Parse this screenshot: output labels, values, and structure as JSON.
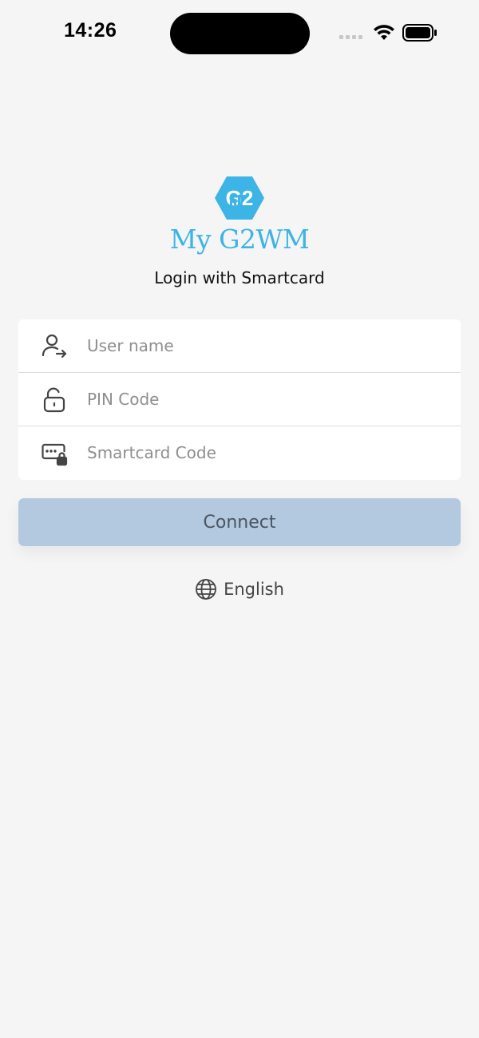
{
  "status_bar": {
    "time": "14:26"
  },
  "app": {
    "logo_text": "My G2WM",
    "logo_mark": "G2",
    "subtitle": "Login with Smartcard",
    "brand_color": "#3db4e6"
  },
  "form": {
    "username": {
      "placeholder": "User name",
      "value": "",
      "icon": "user-arrow-icon"
    },
    "pin": {
      "placeholder": "PIN Code",
      "value": "",
      "icon": "unlock-icon"
    },
    "smartcard": {
      "placeholder": "Smartcard Code",
      "value": "",
      "icon": "smartcard-lock-icon"
    }
  },
  "connect_button": {
    "label": "Connect",
    "color": "#b3c9e0"
  },
  "language": {
    "label": "English",
    "icon": "globe-icon"
  }
}
